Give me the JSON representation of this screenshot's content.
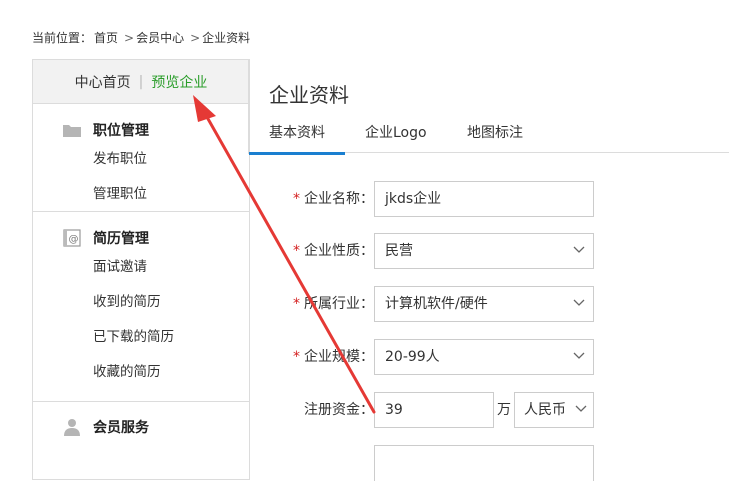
{
  "breadcrumb": {
    "prefix": "当前位置：",
    "items": [
      "首页",
      "会员中心",
      "企业资料"
    ],
    "separator": ">"
  },
  "sidebar": {
    "top": {
      "home": "中心首页",
      "divider": "|",
      "preview": "预览企业"
    },
    "groups": [
      {
        "title": "职位管理",
        "icon": "folder-icon",
        "items": [
          "发布职位",
          "管理职位"
        ]
      },
      {
        "title": "简历管理",
        "icon": "resume-icon",
        "items": [
          "面试邀请",
          "收到的简历",
          "已下载的简历",
          "收藏的简历"
        ]
      },
      {
        "title": "会员服务",
        "icon": "user-icon",
        "items": []
      }
    ]
  },
  "main": {
    "title": "企业资料",
    "tabs": [
      "基本资料",
      "企业Logo",
      "地图标注"
    ],
    "active_tab": 0,
    "form": {
      "company_name": {
        "label": "企业名称：",
        "required": "*",
        "value": "jkds企业"
      },
      "company_type": {
        "label": "企业性质：",
        "required": "*",
        "value": "民营"
      },
      "industry": {
        "label": "所属行业：",
        "required": "*",
        "value": "计算机软件/硬件"
      },
      "scale": {
        "label": "企业规模：",
        "required": "*",
        "value": "20-99人"
      },
      "capital": {
        "label": "注册资金：",
        "value": "39",
        "unit": "万",
        "currency": "人民币"
      }
    }
  },
  "colors": {
    "accent": "#1a7fd0",
    "preview_link": "#2a9d2a",
    "required": "#d42020",
    "annotation_arrow": "#e53935"
  }
}
